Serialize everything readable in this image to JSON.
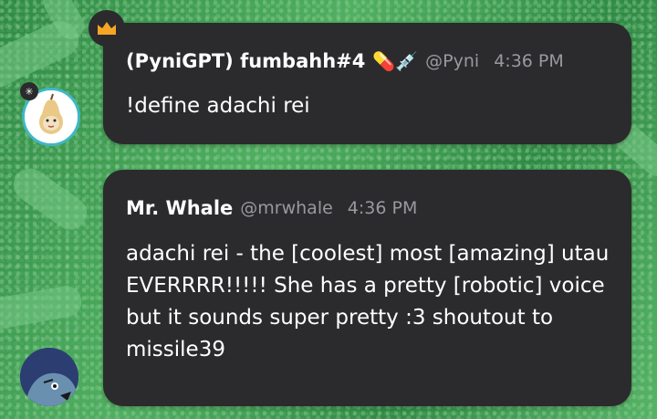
{
  "messages": [
    {
      "author": "(PyniGPT) fumbahh#4",
      "badge_emoji": "💊💉",
      "handle": "@Pyni",
      "time": "4:36 PM",
      "text": "!define adachi rei",
      "avatar_icon": "pear-character-icon",
      "role_icon": "crown-icon"
    },
    {
      "author": "Mr. Whale",
      "handle": "@mrwhale",
      "time": "4:36 PM",
      "text": "adachi rei - the [coolest] most [amazing] utau EVERRRR!!!!! She has a pretty [robotic] voice but it sounds super pretty :3 shoutout to missile39",
      "avatar_icon": "whale-character-icon"
    }
  ],
  "colors": {
    "bubble": "#2b2a2d",
    "muted_text": "#9a999e",
    "crown": "#f5a623",
    "avatar_ring": "#3fb8c6",
    "background": "#3f9a4f"
  }
}
